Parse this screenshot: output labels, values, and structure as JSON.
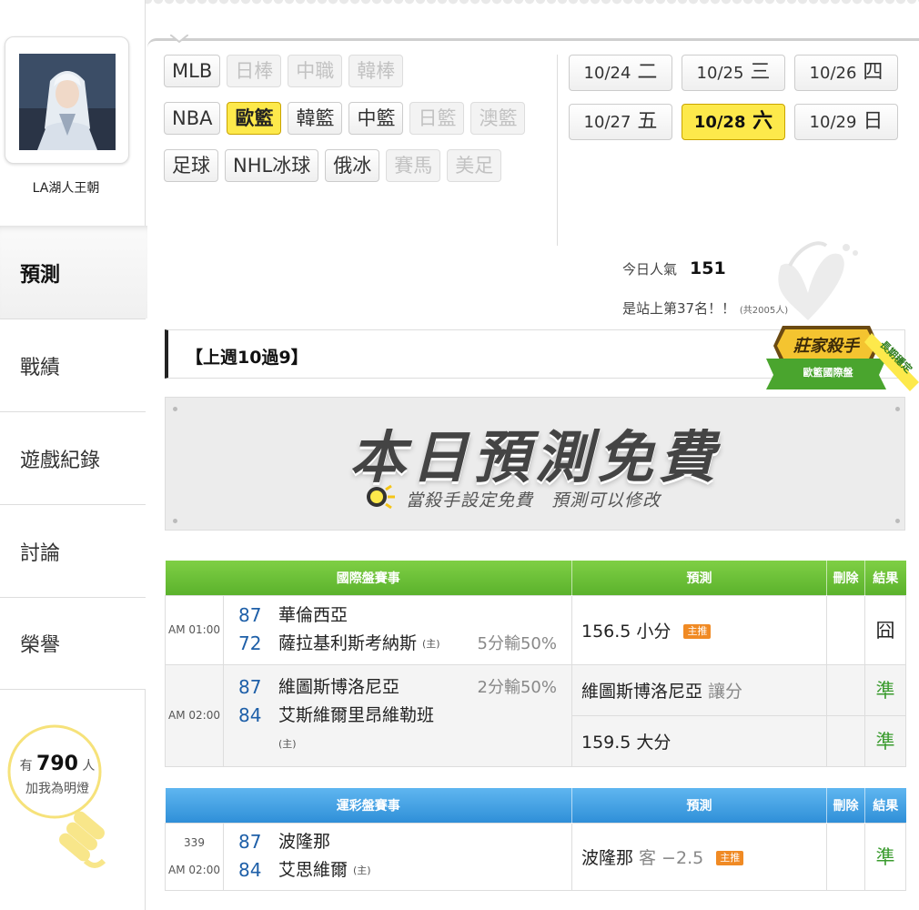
{
  "user": {
    "name": "LA湖人王朝"
  },
  "nav": [
    "預測",
    "戰績",
    "遊戲紀錄",
    "討論",
    "榮譽"
  ],
  "fans": {
    "prefix": "有",
    "count": "790",
    "suffix": "人",
    "line2": "加我為明燈"
  },
  "leagues": {
    "row1": [
      {
        "label": "MLB",
        "state": "normal"
      },
      {
        "label": "日棒",
        "state": "disabled"
      },
      {
        "label": "中職",
        "state": "disabled"
      },
      {
        "label": "韓棒",
        "state": "disabled"
      }
    ],
    "row2": [
      {
        "label": "NBA",
        "state": "normal"
      },
      {
        "label": "歐籃",
        "state": "selected"
      },
      {
        "label": "韓籃",
        "state": "normal"
      },
      {
        "label": "中籃",
        "state": "normal"
      },
      {
        "label": "日籃",
        "state": "disabled"
      },
      {
        "label": "澳籃",
        "state": "disabled"
      }
    ],
    "row3": [
      {
        "label": "足球",
        "state": "normal"
      },
      {
        "label": "NHL冰球",
        "state": "normal"
      },
      {
        "label": "俄冰",
        "state": "normal"
      },
      {
        "label": "賽馬",
        "state": "disabled"
      },
      {
        "label": "美足",
        "state": "disabled"
      }
    ]
  },
  "dates": [
    {
      "date": "10/24",
      "day": "二",
      "selected": false
    },
    {
      "date": "10/25",
      "day": "三",
      "selected": false
    },
    {
      "date": "10/26",
      "day": "四",
      "selected": false
    },
    {
      "date": "10/27",
      "day": "五",
      "selected": false
    },
    {
      "date": "10/28",
      "day": "六",
      "selected": true
    },
    {
      "date": "10/29",
      "day": "日",
      "selected": false
    }
  ],
  "stats": {
    "popularity_label": "今日人氣",
    "popularity_value": "151",
    "rank_text": "是站上第37名！！",
    "rank_total": "(共2005人)"
  },
  "record": {
    "text": "【上週10過9】"
  },
  "badge": {
    "title": "莊家殺手",
    "subtitle": "歐籃國際盤",
    "ribbon": "長期穩定"
  },
  "banner": {
    "title": "本日預測免費",
    "subtitle": "當殺手設定免費　預測可以修改"
  },
  "intl_table": {
    "headers": [
      "國際盤賽事",
      "預測",
      "刪除",
      "結果"
    ],
    "games": [
      {
        "time": "AM 01:00",
        "away": {
          "score": "87",
          "name": "華倫西亞"
        },
        "home": {
          "score": "72",
          "name": "薩拉基利斯考納斯",
          "mark": "(主)",
          "note": "5分輸50%"
        },
        "predictions": [
          {
            "text": "156.5 小分",
            "extra": "",
            "tag": "主推",
            "result": "囧"
          }
        ]
      },
      {
        "time": "AM 02:00",
        "away": {
          "score": "87",
          "name": "維圖斯博洛尼亞",
          "note": "2分輸50%"
        },
        "home": {
          "score": "84",
          "name": "艾斯維爾里昂維勒班",
          "mark": "(主)"
        },
        "predictions": [
          {
            "text": "維圖斯博洛尼亞",
            "extra": "讓分",
            "tag": "",
            "result": "準"
          },
          {
            "text": "159.5 大分",
            "extra": "",
            "tag": "",
            "result": "準"
          }
        ]
      }
    ]
  },
  "lottery_table": {
    "headers": [
      "運彩盤賽事",
      "預測",
      "刪除",
      "結果"
    ],
    "games": [
      {
        "number": "339",
        "time": "AM 02:00",
        "away": {
          "score": "87",
          "name": "波隆那"
        },
        "home": {
          "score": "84",
          "name": "艾思維爾",
          "mark": "(主)"
        },
        "prediction": {
          "text": "波隆那",
          "extra": "客 −2.5",
          "tag": "主推",
          "result": "準"
        }
      }
    ]
  },
  "colors": {
    "accent_yellow": "#fde94b",
    "green_header": "#5bb22c",
    "blue_header": "#2f8fd8",
    "score_blue": "#1e5fa8",
    "result_green": "#3a9b2e"
  }
}
